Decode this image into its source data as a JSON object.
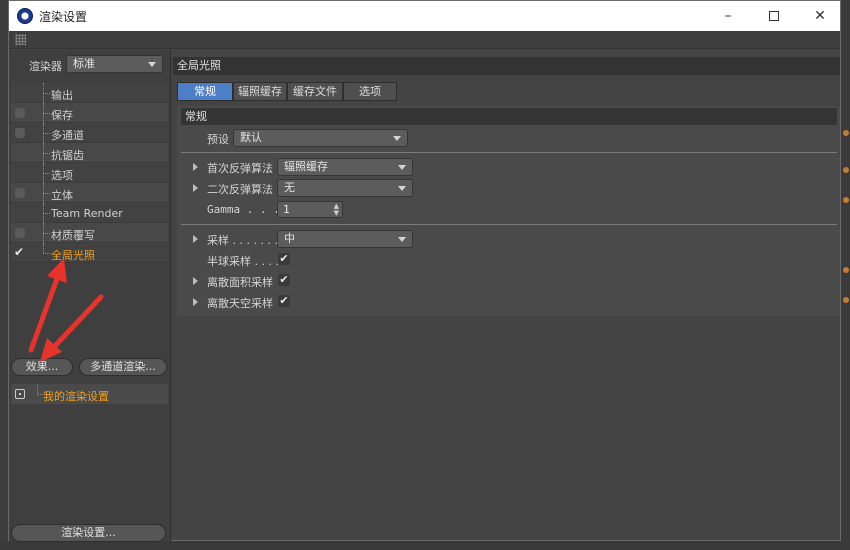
{
  "window": {
    "title": "渲染设置",
    "minimize_glyph": "–",
    "close_glyph": "✕"
  },
  "left": {
    "renderer_label": "渲染器",
    "renderer_value": "标准",
    "tree": [
      {
        "label": "输出",
        "checkbox": false,
        "checked": false
      },
      {
        "label": "保存",
        "checkbox": true,
        "checked": false
      },
      {
        "label": "多通道",
        "checkbox": true,
        "checked": false
      },
      {
        "label": "抗锯齿",
        "checkbox": false,
        "checked": false
      },
      {
        "label": "选项",
        "checkbox": false,
        "checked": false
      },
      {
        "label": "立体",
        "checkbox": true,
        "checked": false
      },
      {
        "label": "Team Render",
        "checkbox": false,
        "checked": false
      },
      {
        "label": "材质覆写",
        "checkbox": true,
        "checked": false
      },
      {
        "label": "全局光照",
        "checkbox": true,
        "checked": true,
        "selected": true
      }
    ],
    "effects_button": "效果...",
    "multipass_button": "多通道渲染...",
    "preset_label": "我的渲染设置",
    "render_settings_button": "渲染设置..."
  },
  "right": {
    "section_title": "全局光照",
    "tabs": [
      "常规",
      "辐照缓存",
      "缓存文件",
      "选项"
    ],
    "active_tab": 0,
    "subhead": "常规",
    "preset_label": "预设",
    "preset_value": "默认",
    "primary_method_label": "首次反弹算法",
    "primary_method_value": "辐照缓存",
    "secondary_method_label": "二次反弹算法",
    "secondary_method_value": "无",
    "gamma_label": "Gamma . . . .",
    "gamma_value": "1",
    "sampling_label": "采样 . . . . . . . .",
    "sampling_value": "中",
    "hemisphere_label": "半球采样 . . . .",
    "hemisphere_checked": true,
    "discrete_area_label": "离散面积采样",
    "discrete_area_checked": true,
    "discrete_sky_label": "离散天空采样",
    "discrete_sky_checked": true,
    "check_glyph": "✔"
  },
  "colors": {
    "accent_tab": "#4d7ec8",
    "selected_text": "#f0a020",
    "annotation_arrow": "#e8322c"
  }
}
